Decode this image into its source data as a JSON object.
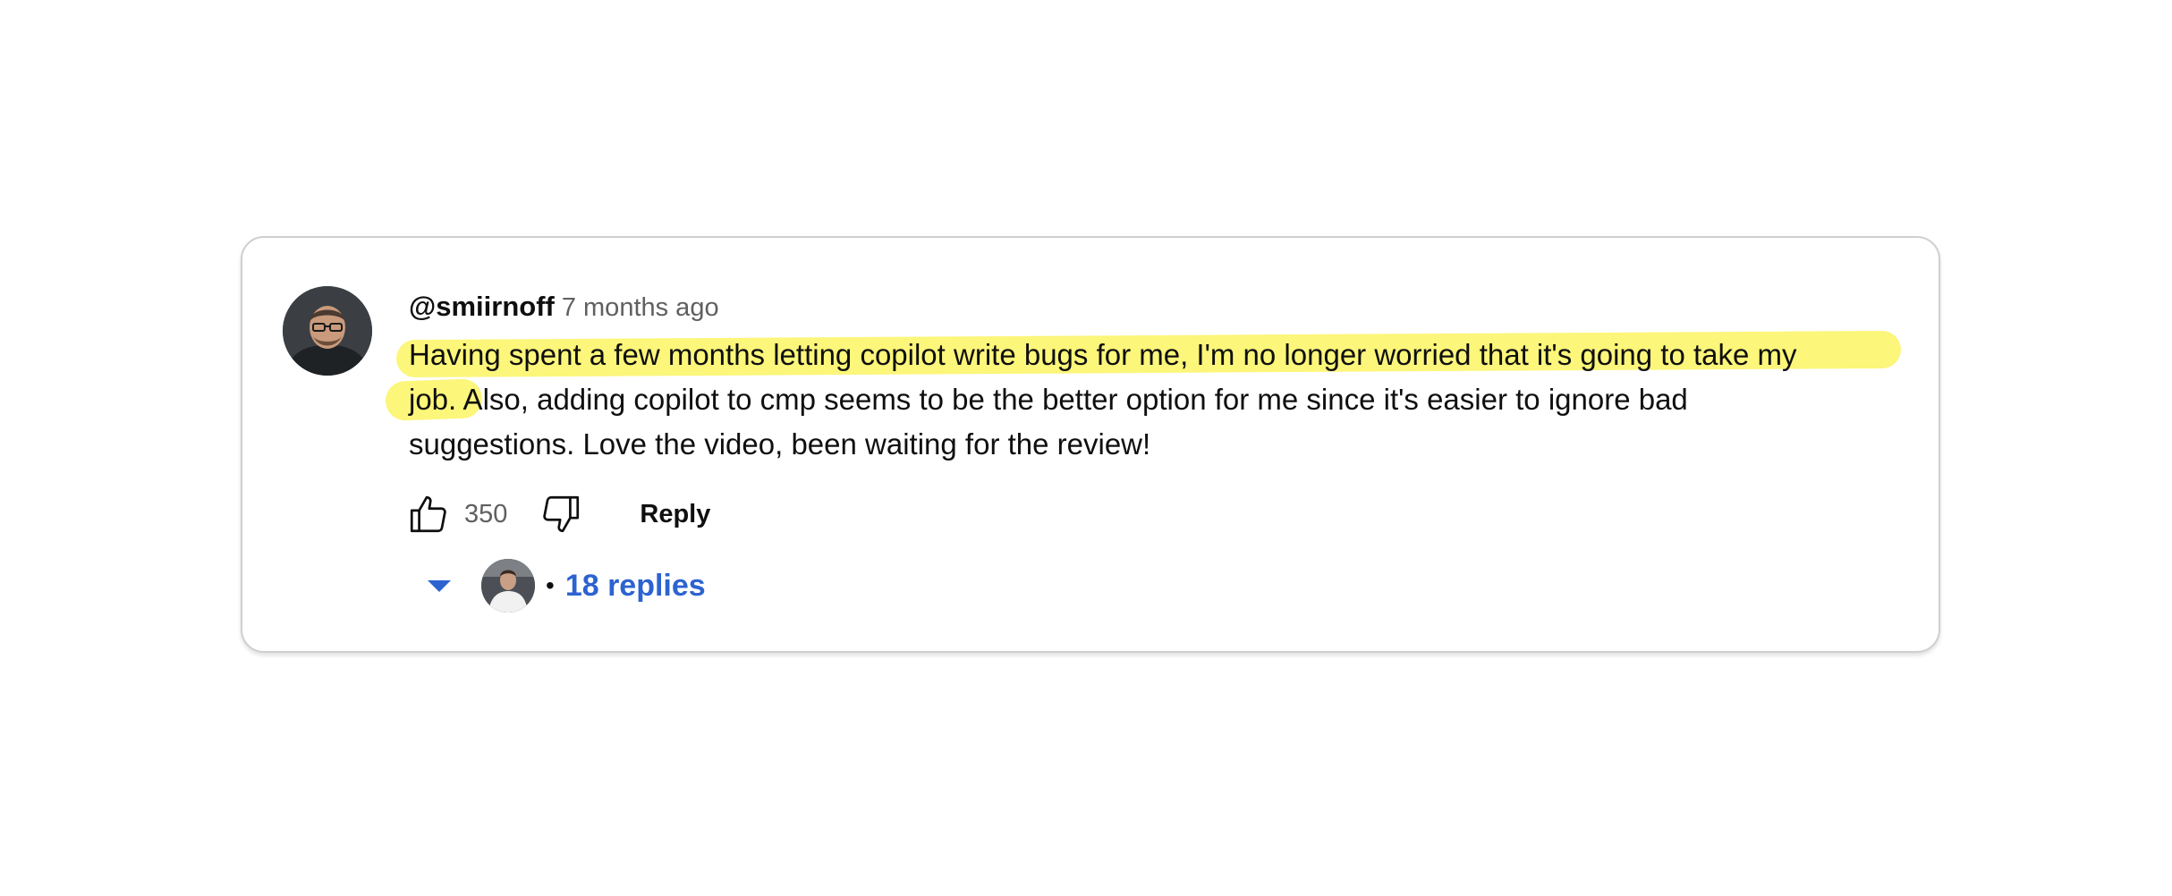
{
  "comment": {
    "author": "@smiirnoff",
    "time": "7 months ago",
    "text_lines": [
      "Having spent a few months letting copilot write bugs for me, I'm no longer worried that it's going to take my",
      "job.  Also, adding copilot to cmp seems to be the better option for me since it's easier to ignore bad",
      "suggestions.  Love the video, been waiting for the review!"
    ],
    "highlighted_text": "Having spent a few months letting copilot write bugs for me, I'm no longer worried that it's going to take my job.",
    "highlight_color": "#fcf67a"
  },
  "actions": {
    "like_icon": "thumbs-up-icon",
    "like_count": "350",
    "dislike_icon": "thumbs-down-icon",
    "reply_label": "Reply"
  },
  "replies": {
    "expand_icon": "caret-down-icon",
    "separator": "•",
    "label": "18 replies",
    "link_color": "#2d63d0"
  }
}
